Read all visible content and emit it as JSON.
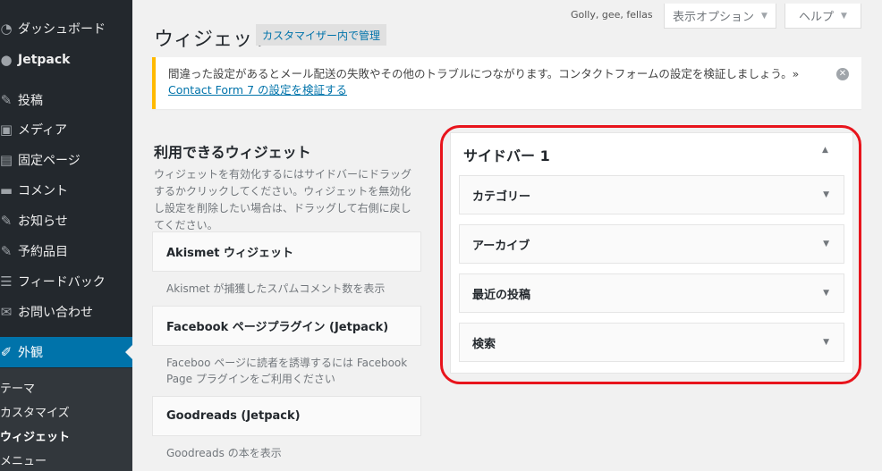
{
  "admin_menu": {
    "items": [
      {
        "icon": "dashboard-icon",
        "glyph": "◔",
        "label": "ダッシュボード"
      },
      {
        "icon": "jetpack-icon",
        "glyph": "●",
        "label": "Jetpack"
      },
      {
        "icon": "pin-icon",
        "glyph": "✎",
        "label": "投稿"
      },
      {
        "icon": "media-icon",
        "glyph": "▣",
        "label": "メディア"
      },
      {
        "icon": "page-icon",
        "glyph": "▤",
        "label": "固定ページ"
      },
      {
        "icon": "comment-icon",
        "glyph": "▬",
        "label": "コメント"
      },
      {
        "icon": "pin-icon",
        "glyph": "✎",
        "label": "お知らせ"
      },
      {
        "icon": "pin-icon",
        "glyph": "✎",
        "label": "予約品目"
      },
      {
        "icon": "list-icon",
        "glyph": "☰",
        "label": "フィードバック"
      },
      {
        "icon": "mail-icon",
        "glyph": "✉",
        "label": "お問い合わせ"
      }
    ],
    "active": {
      "icon": "brush-icon",
      "glyph": "✐",
      "label": "外観"
    },
    "submenu": [
      "テーマ",
      "カスタマイズ",
      "ウィジェット",
      "メニュー"
    ]
  },
  "topbar": {
    "username": "Golly, gee, fellas",
    "screen_options": "表示オプション",
    "help": "ヘルプ"
  },
  "page": {
    "title": "ウィジェット",
    "action": "カスタマイザー内で管理"
  },
  "notice": {
    "text": "間違った設定があるとメール配送の失敗やその他のトラブルにつながります。コンタクトフォームの設定を検証しましょう。» ",
    "link": "Contact Form 7 の設定を検証する"
  },
  "available": {
    "title": "利用できるウィジェット",
    "description": "ウィジェットを有効化するにはサイドバーにドラッグするかクリックしてください。ウィジェットを無効化し設定を削除したい場合は、ドラッグして右側に戻してください。",
    "widgets": [
      {
        "name": "Akismet ウィジェット",
        "desc": "Akismet が捕獲したスパムコメント数を表示"
      },
      {
        "name": "Facebook ページプラグイン (Jetpack)",
        "desc": "Faceboo ページに読者を誘導するには Facebook Page プラグインをご利用ください"
      },
      {
        "name": "Goodreads (Jetpack)",
        "desc": "Goodreads の本を表示"
      }
    ]
  },
  "sidebar_area": {
    "title": "サイドバー 1",
    "widgets": [
      "カテゴリー",
      "アーカイブ",
      "最近の投稿",
      "検索"
    ]
  },
  "colors": {
    "admin_bg": "#23282d",
    "active_menu": "#0073aa",
    "notice_border": "#ffb900",
    "highlight": "#e8141c"
  }
}
